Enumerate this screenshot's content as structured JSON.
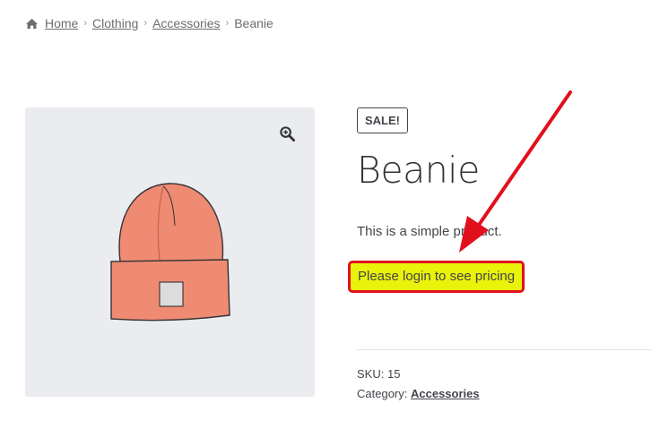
{
  "breadcrumb": {
    "home": "Home",
    "items": [
      "Clothing",
      "Accessories"
    ],
    "current": "Beanie",
    "separator": "›"
  },
  "gallery": {
    "zoom_icon": "zoom-in-icon",
    "image": "beanie-product-image"
  },
  "product": {
    "badge": "SALE!",
    "title": "Beanie",
    "short_description": "This is a simple product.",
    "login_notice": "Please login to see pricing",
    "sku_label": "SKU:",
    "sku_value": "15",
    "category_label": "Category:",
    "category_value": "Accessories"
  },
  "colors": {
    "highlight_bg": "#e9f20a",
    "highlight_border": "#e2101d",
    "arrow": "#e2101d",
    "gallery_bg": "#eaecef"
  }
}
